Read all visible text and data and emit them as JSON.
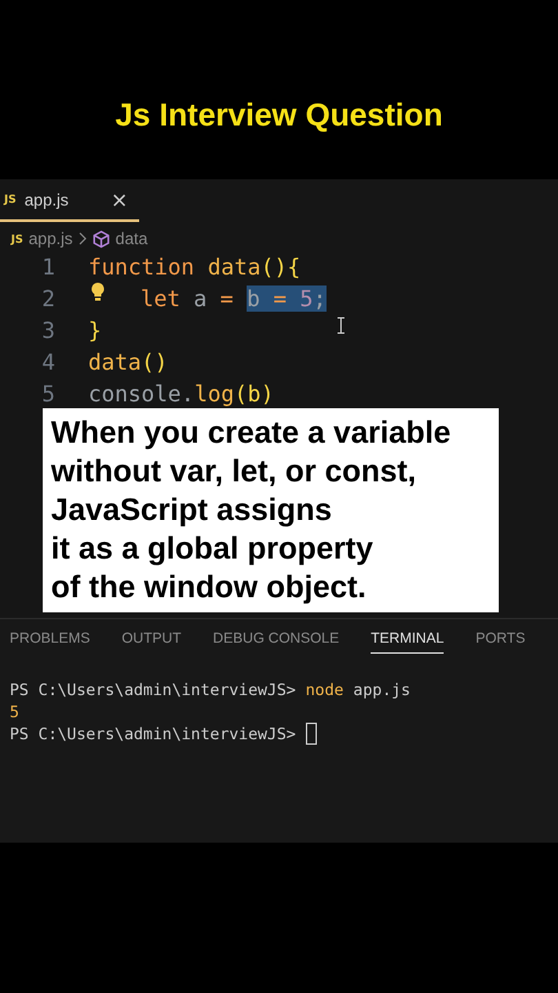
{
  "title": "Js Interview Question",
  "editor": {
    "tab": {
      "icon": "JS",
      "label": "app.js",
      "close": "×",
      "selected": true
    },
    "breadcrumb": [
      {
        "icon": "JS",
        "label": "app.js"
      },
      {
        "label": "data",
        "kind": "symbol"
      }
    ],
    "lines": [
      {
        "number": "1",
        "lightbulb": false,
        "tokens": [
          {
            "text": "function ",
            "kind": "keyword",
            "selected": false
          },
          {
            "text": "data",
            "kind": "name",
            "selected": false
          },
          {
            "text": "(){",
            "kind": "brace",
            "selected": false
          }
        ]
      },
      {
        "number": "2",
        "lightbulb": true,
        "indented": true,
        "tokens": [
          {
            "text": "let ",
            "kind": "keyword",
            "selected": false
          },
          {
            "text": "a ",
            "kind": "plain",
            "selected": false
          },
          {
            "text": "= ",
            "kind": "keyword",
            "selected": false
          },
          {
            "text": "b ",
            "kind": "plain",
            "selected": true
          },
          {
            "text": "= ",
            "kind": "keyword",
            "selected": true
          },
          {
            "text": "5",
            "kind": "number",
            "selected": true
          },
          {
            "text": ";",
            "kind": "plain",
            "selected": true
          }
        ]
      },
      {
        "number": "3",
        "lightbulb": false,
        "tokens": [
          {
            "text": "}",
            "kind": "brace",
            "selected": false
          }
        ]
      },
      {
        "number": "4",
        "lightbulb": false,
        "tokens": [
          {
            "text": "data",
            "kind": "name",
            "selected": false
          },
          {
            "text": "()",
            "kind": "brace",
            "selected": false
          }
        ]
      },
      {
        "number": "5",
        "lightbulb": false,
        "tokens": [
          {
            "text": "console.",
            "kind": "plain",
            "selected": false
          },
          {
            "text": "log",
            "kind": "name",
            "selected": false
          },
          {
            "text": "(b)",
            "kind": "brace",
            "selected": false
          }
        ]
      }
    ]
  },
  "caption": [
    "When you create a variable",
    "without var, let, or const,",
    "JavaScript assigns",
    "it as a global property",
    "of the window object."
  ],
  "panel": {
    "tabs": [
      {
        "label": "PROBLEMS",
        "selected": false
      },
      {
        "label": "OUTPUT",
        "selected": false
      },
      {
        "label": "DEBUG CONSOLE",
        "selected": false
      },
      {
        "label": "TERMINAL",
        "selected": true
      },
      {
        "label": "PORTS",
        "selected": false
      }
    ],
    "terminal": [
      {
        "kind": "command",
        "prompt": "PS C:\\Users\\admin\\interviewJS>",
        "command": "node",
        "args": "app.js"
      },
      {
        "kind": "output",
        "text": "5"
      },
      {
        "kind": "cursor",
        "prompt": "PS C:\\Users\\admin\\interviewJS>"
      }
    ]
  }
}
